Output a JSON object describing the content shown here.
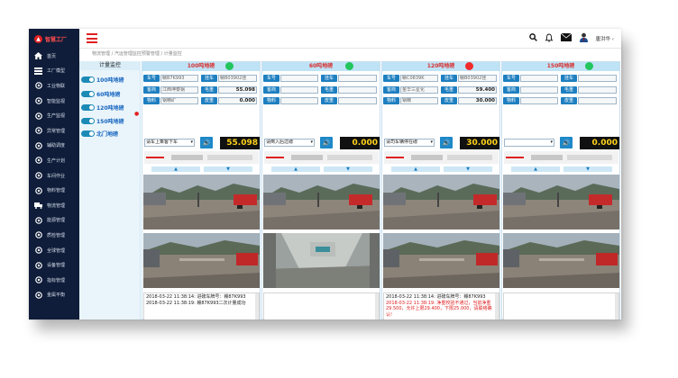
{
  "app": {
    "logo_text": "智慧工厂",
    "user_name": "唐洪华",
    "user_caret": "‹"
  },
  "breadcrumb": "物流管理 / 汽运管理监控预警管理 / 计量监控",
  "sidebar": {
    "items": [
      {
        "label": "首页",
        "icon": "home-icon"
      },
      {
        "label": "工厂模型",
        "icon": "list-icon"
      },
      {
        "label": "工业物联",
        "icon": "globe-icon"
      },
      {
        "label": "智能监视",
        "icon": "dashboard-icon"
      },
      {
        "label": "生产监视",
        "icon": "gear-icon"
      },
      {
        "label": "异常管理",
        "icon": "table-icon"
      },
      {
        "label": "辅助调度",
        "icon": "sliders-icon"
      },
      {
        "label": "生产计划",
        "icon": "wrench-icon"
      },
      {
        "label": "车间作业",
        "icon": "cube-icon"
      },
      {
        "label": "物料管理",
        "icon": "cubes-icon"
      },
      {
        "label": "物流管理",
        "icon": "truck-icon"
      },
      {
        "label": "能源管理",
        "icon": "bolt-icon"
      },
      {
        "label": "质检管理",
        "icon": "chart-icon"
      },
      {
        "label": "全球管理",
        "icon": "globe2-icon"
      },
      {
        "label": "设备管理",
        "icon": "cog-icon"
      },
      {
        "label": "指标管理",
        "icon": "link-icon"
      },
      {
        "label": "金属平衡",
        "icon": "scale-icon"
      }
    ]
  },
  "left_panel": {
    "title": "计量监控",
    "items": [
      "100吨地磅",
      "60吨地磅",
      "120吨地磅",
      "150吨地磅",
      "北门地磅"
    ],
    "marker": "●"
  },
  "labels": {
    "plate": "车号",
    "trailer": "挂车",
    "customer": "客商",
    "gross": "毛重",
    "material": "物料",
    "tare": "皮重",
    "up": "▲",
    "down": "▼"
  },
  "colors": {
    "green": "#22c55e",
    "red": "#ef2b2b"
  },
  "cards": [
    {
      "title": "100吨地磅",
      "light": "green",
      "plate": "赣B7K993",
      "trailer": "赣B03902挂",
      "customer": "江西坤泰钢",
      "gross": "55.098",
      "material": "钢精矿",
      "tare": "0.000",
      "select": "请车上乘客下车",
      "weight": "55.098",
      "log": [
        {
          "t": "2018-03-22 11:38:14: 进磅车牌号：赣87K993",
          "red": false
        },
        {
          "t": "2018-03-22 11:38:19: 赣87K993二次计量成功",
          "red": false
        }
      ]
    },
    {
      "title": "60吨地磅",
      "light": "green",
      "plate": "",
      "trailer": "",
      "customer": "",
      "gross": "",
      "material": "",
      "tare": "",
      "select": "请倒入后过磅",
      "weight": "0.000",
      "log": []
    },
    {
      "title": "120吨地磅",
      "light": "red",
      "plate": "赣C0839K",
      "trailer": "赣B03902挂",
      "customer": "金华三星化",
      "gross": "59.400",
      "material": "钢精",
      "tare": "30.000",
      "select": "请司车辆停在磅",
      "weight": "30.000",
      "log": [
        {
          "t": "2018-03-22 11:38:14: 进磅车牌号：赣87K993",
          "red": false
        },
        {
          "t": "2018-03-22 11:38:19: 净重校验不通过，当前净重29.500，允许上限29.400，下限25.000，请联络确认!",
          "red": true
        }
      ]
    },
    {
      "title": "150吨地磅",
      "light": "green",
      "plate": "",
      "trailer": "",
      "customer": "",
      "gross": "",
      "material": "",
      "tare": "",
      "select": "",
      "weight": "0.000",
      "log": []
    }
  ]
}
